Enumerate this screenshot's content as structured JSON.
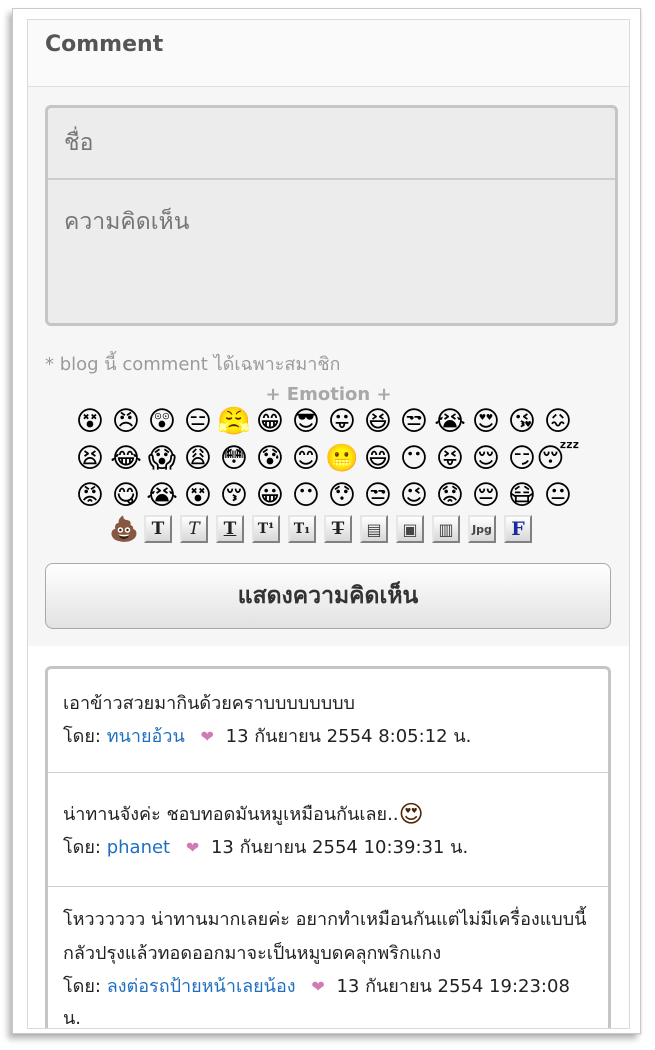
{
  "header": {
    "title": "Comment"
  },
  "form": {
    "name_placeholder": "ชื่อ",
    "comment_placeholder": "ความคิดเห็น",
    "note": "* blog นี้ comment ได้เฉพาะสมาชิก",
    "emotion_label": "+ Emotion +",
    "submit_label": "แสดงความคิดเห็น"
  },
  "emojis": [
    "😵",
    "😠",
    "😲",
    "😑",
    "😤",
    "😁",
    "😎",
    "😛",
    "😆",
    "😒",
    "😭",
    "😍",
    "😘",
    "😖",
    "😫",
    "😂",
    "😱",
    "😩",
    "😳",
    "😰",
    "😊",
    "😬",
    "😄",
    "😶",
    "😝",
    "😌",
    "😏",
    "😴",
    "😡",
    "😋",
    "😭",
    "😵",
    "😚",
    "😀",
    "😶",
    "😯",
    "😒",
    "😉",
    "😟",
    "😔",
    "😷",
    "😐"
  ],
  "toolbar": {
    "poop_icon": "💩",
    "buttons": [
      "T",
      "T",
      "T",
      "T¹",
      "T₁",
      "T̶",
      "▤",
      "▣",
      "▥",
      "Jpg",
      "F"
    ]
  },
  "comments": [
    {
      "text": "เอาข้าวสวยมากินด้วยคราบบบบบบบบ",
      "by_label": "โดย:",
      "author": "ทนายอ้วน",
      "timestamp": "13 กันยายน 2554 8:05:12 น."
    },
    {
      "text": "น่าทานจังค่ะ ชอบทอดมันหมูเหมือนกันเลย..",
      "emoji": "😍",
      "by_label": "โดย:",
      "author": "phanet",
      "timestamp": "13 กันยายน 2554 10:39:31 น."
    },
    {
      "text": "โหวววววว น่าทานมากเลยค่ะ อยากทำเหมือนกันแต่ไม่มีเครื่องแบบนี้ กลัวปรุงแล้วทอดออกมาจะเป็นหมูบดคลุกพริกแกง",
      "by_label": "โดย:",
      "author": "ลงต่อรถป้ายหน้าเลยน้อง",
      "timestamp": "13 กันยายน 2554 19:23:08 น."
    }
  ]
}
